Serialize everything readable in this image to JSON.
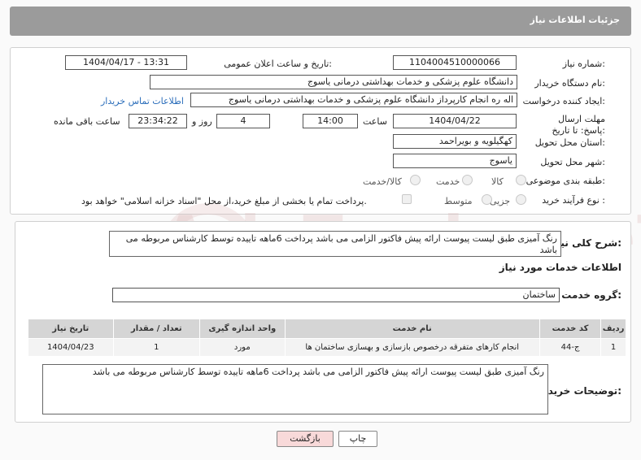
{
  "header": {
    "title": "جزئیات اطلاعات نیاز"
  },
  "info": {
    "need_number_label": "شماره نیاز:",
    "need_number": "1104004510000066",
    "announce_label": "تاریخ و ساعت اعلان عمومی:",
    "announce_value": "1404/04/17 - 13:31",
    "buyer_org_label": "نام دستگاه خریدار:",
    "buyer_org": "دانشگاه علوم پزشکی و خدمات بهداشتی  درمانی یاسوج",
    "creator_label": "ایجاد کننده درخواست:",
    "creator": "اله ره انجام کارپرداز دانشگاه علوم پزشکی و خدمات بهداشتی  درمانی یاسوج",
    "contact_link": "اطلاعات تماس خریدار",
    "deadline_label": "مهلت ارسال پاسخ: تا تاریخ:",
    "deadline_date": "1404/04/22",
    "time_label": "ساعت",
    "deadline_time": "14:00",
    "days_value": "4",
    "days_label": "روز و",
    "remaining_time": "23:34:22",
    "remaining_label": "ساعت باقی مانده",
    "province_label": "استان محل تحویل:",
    "province": "کهگیلویه و بویراحمد",
    "city_label": "شهر محل تحویل:",
    "city": "یاسوج",
    "category_label": "طبقه بندی موضوعی:",
    "category_options": [
      "کالا",
      "خدمت",
      "کالا/خدمت"
    ],
    "process_label": "نوع فرآیند خرید :",
    "process_options": [
      "جزیی",
      "متوسط"
    ],
    "payment_note": "پرداخت تمام یا بخشی از مبلغ خرید،از محل \"اسناد خزانه اسلامی\" خواهد بود."
  },
  "description": {
    "label": "شرح کلی نیاز:",
    "text": "رنگ آمیزی طبق لیست پیوست ارائه پیش فاکتور الزامی می باشد پرداخت 6ماهه تاییده توسط کارشناس مربوطه می باشد"
  },
  "services": {
    "section_title": "اطلاعات خدمات مورد نیاز",
    "group_label": "گروه خدمت:",
    "group_value": "ساختمان",
    "columns": [
      "ردیف",
      "کد خدمت",
      "نام خدمت",
      "واحد اندازه گیری",
      "تعداد / مقدار",
      "تاریخ نیاز"
    ],
    "rows": [
      {
        "row": "1",
        "code": "ج-44",
        "name": "انجام کارهای متفرقه درخصوص بازسازی و بهسازی ساختمان ها",
        "unit": "مورد",
        "qty": "1",
        "date": "1404/04/23"
      }
    ]
  },
  "buyer_notes": {
    "label": "توضیحات خریدار:",
    "text": "رنگ آمیزی طبق لیست پیوست ارائه پیش فاکتور الزامی می باشد پرداخت 6ماهه تاییده توسط کارشناس مربوطه می باشد"
  },
  "buttons": {
    "print": "چاپ",
    "back": "بازگشت"
  },
  "watermark": "AriaTender.neT",
  "colors": {
    "header_bg": "#9b9b9b",
    "link": "#2a6dba",
    "back_btn_bg": "#f8d9d9"
  }
}
